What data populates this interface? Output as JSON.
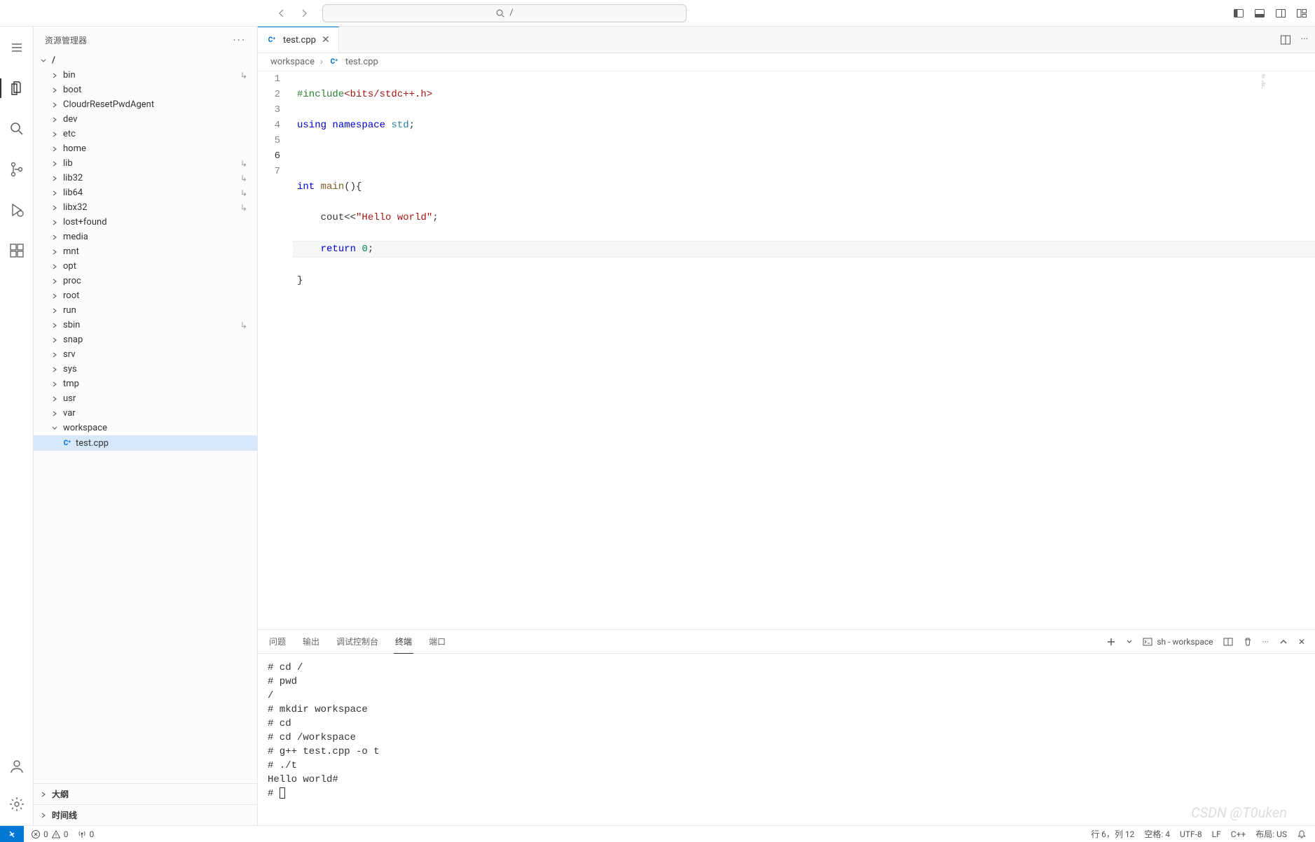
{
  "titlebar": {
    "search_placeholder": "/"
  },
  "sidebar": {
    "title": "资源管理器",
    "root": "/",
    "items": [
      {
        "label": "bin",
        "badge": "↳"
      },
      {
        "label": "boot"
      },
      {
        "label": "CloudrResetPwdAgent"
      },
      {
        "label": "dev"
      },
      {
        "label": "etc"
      },
      {
        "label": "home"
      },
      {
        "label": "lib",
        "badge": "↳"
      },
      {
        "label": "lib32",
        "badge": "↳"
      },
      {
        "label": "lib64",
        "badge": "↳"
      },
      {
        "label": "libx32",
        "badge": "↳"
      },
      {
        "label": "lost+found"
      },
      {
        "label": "media"
      },
      {
        "label": "mnt"
      },
      {
        "label": "opt"
      },
      {
        "label": "proc"
      },
      {
        "label": "root"
      },
      {
        "label": "run"
      },
      {
        "label": "sbin",
        "badge": "↳"
      },
      {
        "label": "snap"
      },
      {
        "label": "srv"
      },
      {
        "label": "sys"
      },
      {
        "label": "tmp"
      },
      {
        "label": "usr"
      },
      {
        "label": "var"
      }
    ],
    "workspace": {
      "label": "workspace",
      "file": "test.cpp"
    },
    "sections": {
      "outline": "大纲",
      "timeline": "时间线"
    }
  },
  "tabs": {
    "open": "test.cpp"
  },
  "breadcrumb": {
    "a": "workspace",
    "b": "test.cpp"
  },
  "code": {
    "lines": [
      {
        "n": "1"
      },
      {
        "n": "2"
      },
      {
        "n": "3"
      },
      {
        "n": "4"
      },
      {
        "n": "5"
      },
      {
        "n": "6"
      },
      {
        "n": "7"
      }
    ],
    "tok": {
      "include": "#include",
      "header": "<bits/stdc++.h>",
      "using": "using",
      "namespace": "namespace",
      "std": "std",
      "semi": ";",
      "int": "int",
      "main": "main",
      "paren": "(){",
      "cout": "cout<<",
      "string": "\"Hello world\"",
      "return": "return",
      "zero": "0",
      "cbrace": "}"
    }
  },
  "panel": {
    "tabs": {
      "problems": "问题",
      "output": "输出",
      "debug": "调试控制台",
      "terminal": "终端",
      "ports": "端口"
    },
    "shell_label": "sh - workspace",
    "terminal_text": "# cd /\n# pwd\n/\n# mkdir workspace\n# cd\n# cd /workspace\n# g++ test.cpp -o t\n# ./t\nHello world#\n# "
  },
  "status": {
    "errors": "0",
    "warnings": "0",
    "ports": "0",
    "position": "行 6，列 12",
    "spaces": "空格: 4",
    "encoding": "UTF-8",
    "eol": "LF",
    "lang": "C++",
    "layout": "布局: US"
  },
  "watermark": "CSDN @T0uken"
}
